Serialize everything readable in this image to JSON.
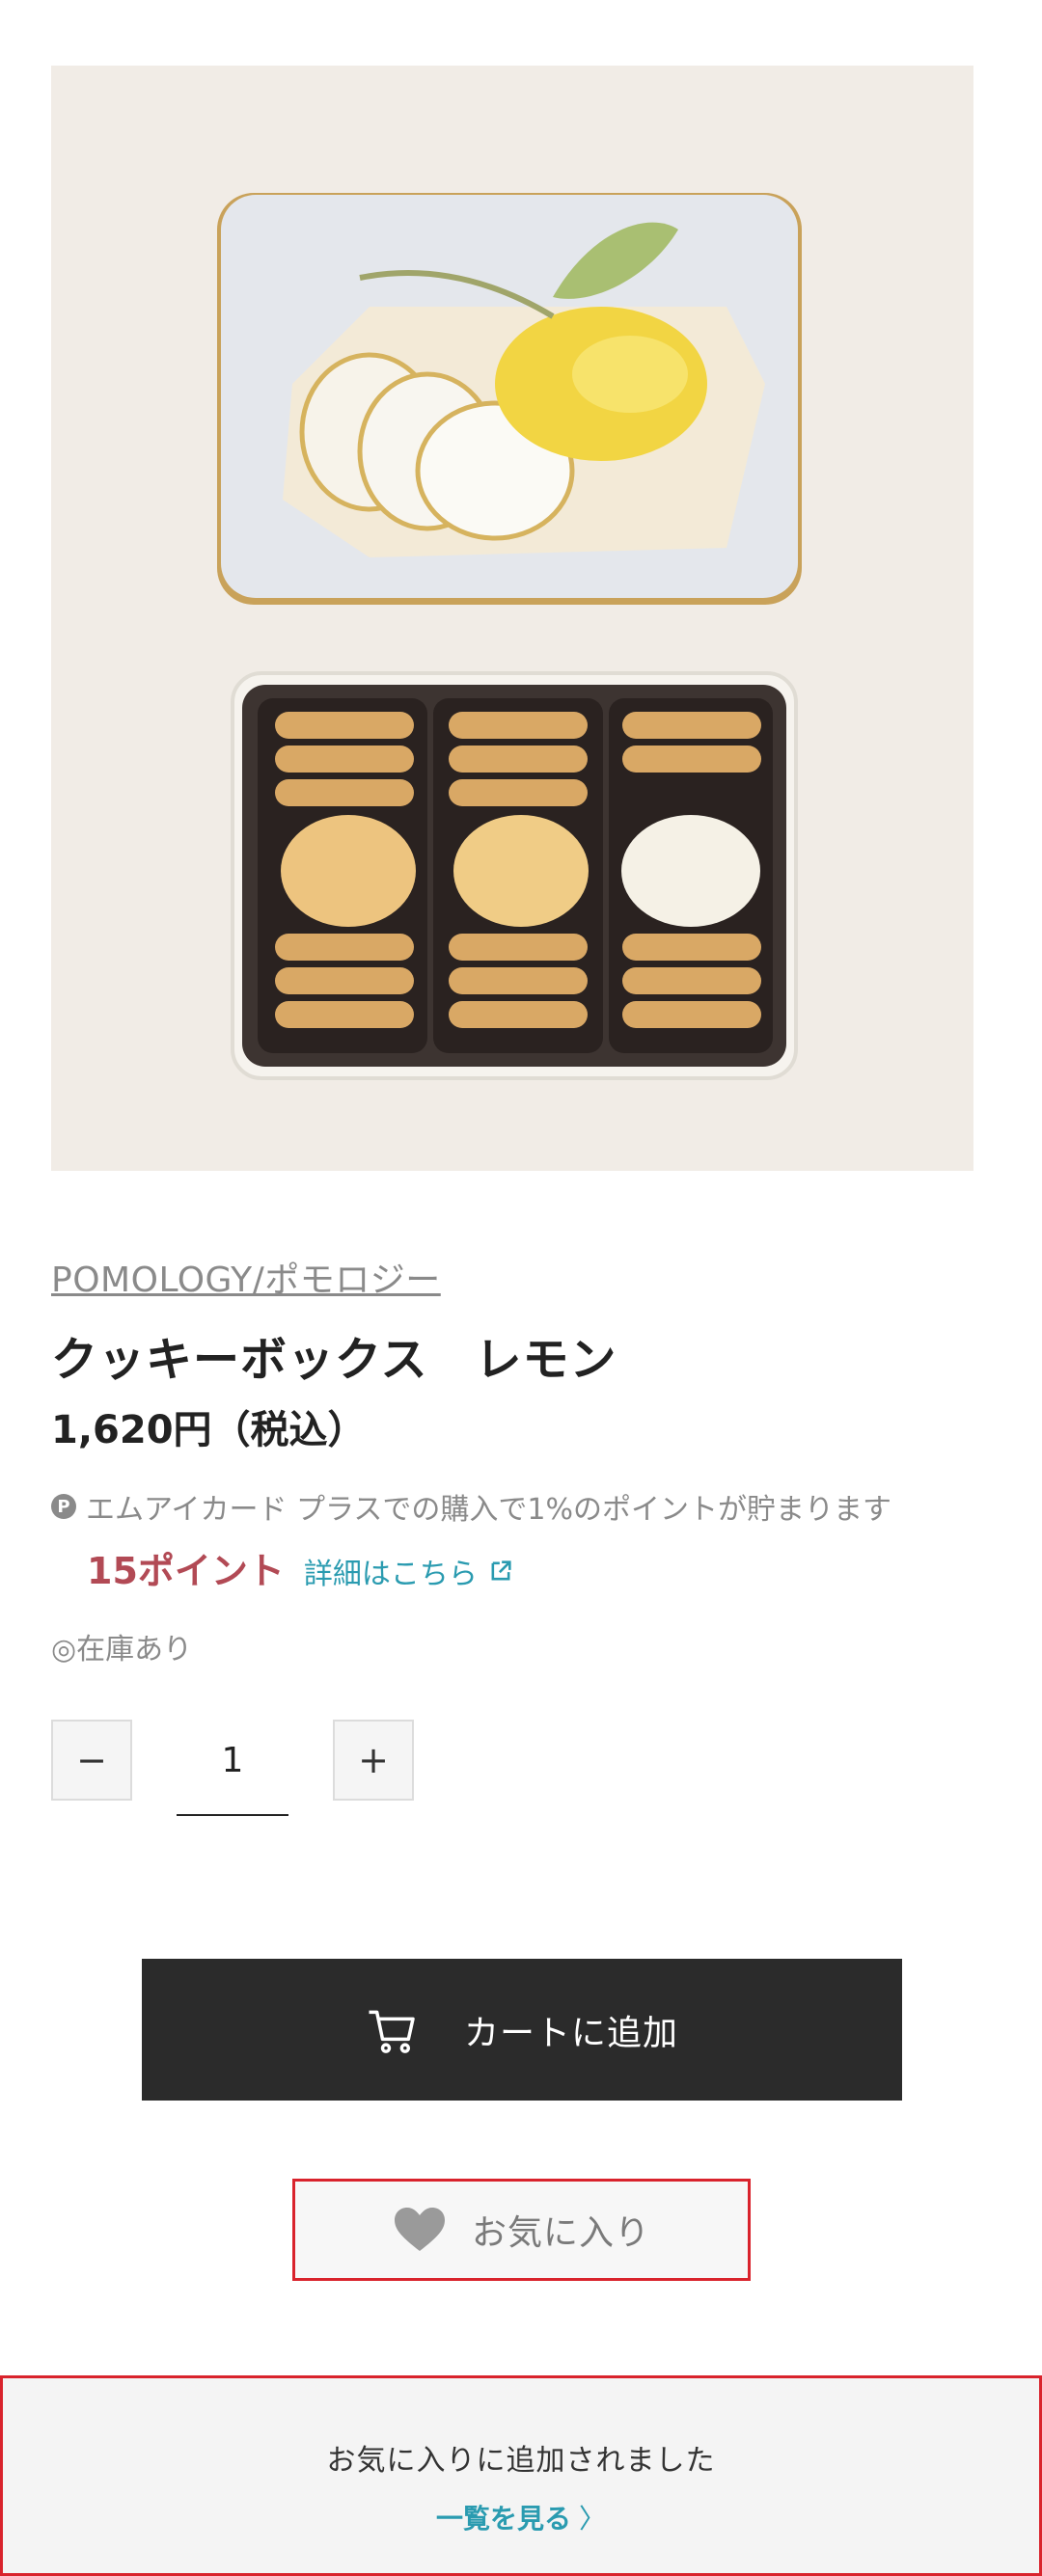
{
  "product": {
    "brand": "POMOLOGY/ポモロジー",
    "title": "クッキーボックス　レモン",
    "price": "1,620円（税込）",
    "image_alt": "クッキーボックス レモン"
  },
  "points": {
    "badge": "P",
    "note": "エムアイカード プラスでの購入で1%のポイントが貯まります",
    "value": "15ポイント",
    "detail_link": "詳細はこちら"
  },
  "stock": {
    "status": "◎在庫あり"
  },
  "quantity": {
    "minus_label": "−",
    "plus_label": "+",
    "value": "1"
  },
  "actions": {
    "cart_label": "カートに追加",
    "favorite_label": "お気に入り"
  },
  "toast": {
    "message": "お気に入りに追加されました",
    "link_label": "一覧を見る",
    "link_chevron": "〉"
  },
  "colors": {
    "accent_teal": "#2a9bb0",
    "points_red": "#b24a55",
    "highlight_red": "#d9232c",
    "cart_bg": "#2b2b2b"
  }
}
